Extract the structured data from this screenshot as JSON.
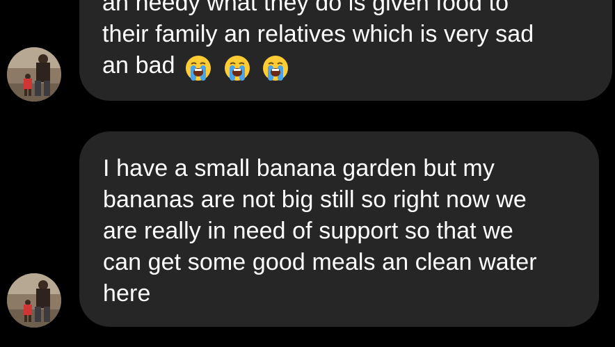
{
  "messages": [
    {
      "lines": [
        "an needy what they do is given food to",
        "their family an relatives which is very sad",
        "an bad"
      ],
      "emojis": [
        "loudly-crying-face-icon",
        "loudly-crying-face-icon",
        "loudly-crying-face-icon"
      ]
    },
    {
      "lines": [
        "I have a small banana garden but my",
        "bananas are not big still so right now we",
        "are really in need of support so that we",
        "can get some good meals an clean water",
        "here"
      ]
    }
  ],
  "colors": {
    "background": "#000000",
    "bubble": "#262626",
    "text": "#ffffff"
  }
}
